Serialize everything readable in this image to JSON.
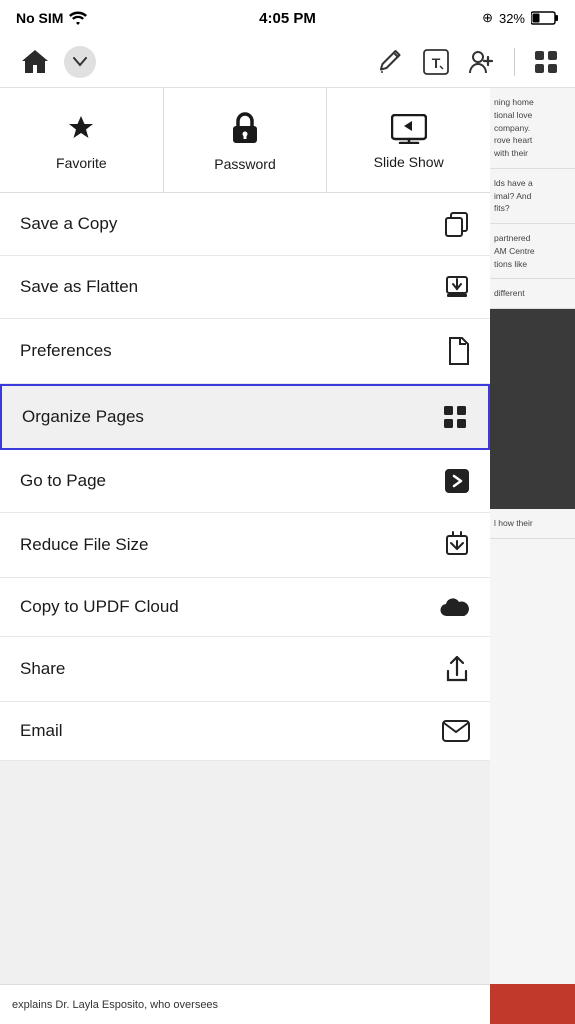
{
  "statusBar": {
    "carrier": "No SIM",
    "time": "4:05 PM",
    "location": "⊕",
    "battery": "32%"
  },
  "toolbar": {
    "home": "home",
    "chevron": "▾",
    "tools": [
      "pencil",
      "text",
      "person-add",
      "grid"
    ]
  },
  "topActions": [
    {
      "id": "favorite",
      "label": "Favorite",
      "icon": "★"
    },
    {
      "id": "password",
      "label": "Password",
      "icon": "🔒"
    },
    {
      "id": "slideshow",
      "label": "Slide Show",
      "icon": "📺"
    }
  ],
  "menuItems": [
    {
      "id": "save-copy",
      "label": "Save a Copy",
      "icon": "copy"
    },
    {
      "id": "save-flatten",
      "label": "Save as Flatten",
      "icon": "download"
    },
    {
      "id": "preferences",
      "label": "Preferences",
      "icon": "document"
    },
    {
      "id": "organize-pages",
      "label": "Organize Pages",
      "icon": "grid",
      "highlighted": true
    },
    {
      "id": "go-to-page",
      "label": "Go to Page",
      "icon": "arrow-right"
    },
    {
      "id": "reduce-file",
      "label": "Reduce File Size",
      "icon": "compress"
    },
    {
      "id": "copy-cloud",
      "label": "Copy to UPDF Cloud",
      "icon": "cloud"
    },
    {
      "id": "share",
      "label": "Share",
      "icon": "share"
    },
    {
      "id": "email",
      "label": "Email",
      "icon": "email"
    }
  ],
  "rightTexts": [
    "ning home\ntional love\n company.\nrove heart\nwith their",
    "lds have a\nimal? And\nfits?",
    "partnered\nAM Centre\ntions like",
    "different"
  ],
  "bottomText": "explains Dr. Layla Esposito, who oversees"
}
